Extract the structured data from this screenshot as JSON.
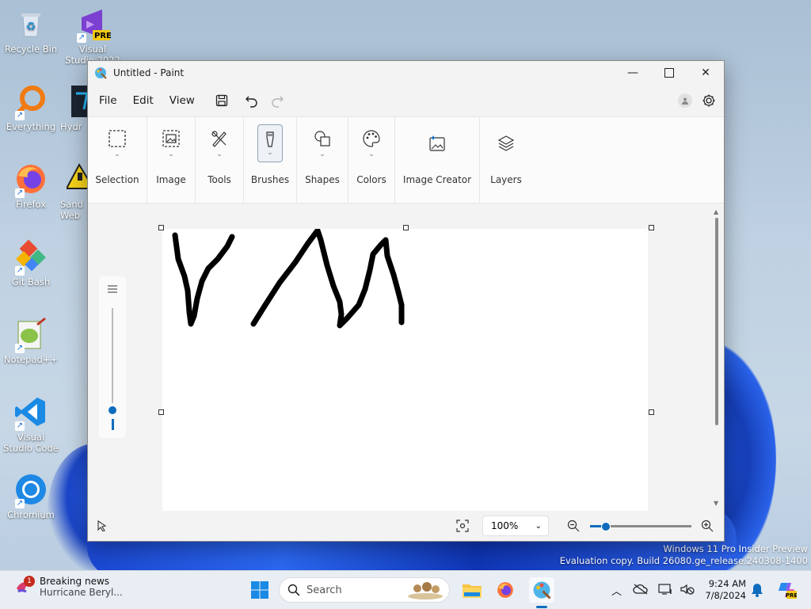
{
  "desktop": {
    "icons": [
      {
        "label": "Recycle Bin"
      },
      {
        "label": "Visual Studio 2022",
        "badge": "PRE"
      },
      {
        "label": "Everything"
      },
      {
        "label": "Hydr"
      },
      {
        "label": "Firefox"
      },
      {
        "label": "Sand Web"
      },
      {
        "label": "Git Bash"
      },
      {
        "label": "Notepad++"
      },
      {
        "label": "Visual Studio Code"
      },
      {
        "label": "Chromium"
      }
    ],
    "watermark": {
      "line1": "Windows 11 Pro Insider Preview",
      "line2": "Evaluation copy. Build 26080.ge_release.240308-1400"
    }
  },
  "paint": {
    "title": "Untitled - Paint",
    "menu": [
      "File",
      "Edit",
      "View"
    ],
    "ribbon": {
      "groups": [
        "Selection",
        "Image",
        "Tools",
        "Brushes",
        "Shapes",
        "Colors",
        "Image Creator",
        "Layers"
      ]
    },
    "status": {
      "zoom": "100%"
    }
  },
  "taskbar": {
    "news_title": "Breaking news",
    "news_sub": "Hurricane Beryl...",
    "news_badge": "1",
    "search_label": "Search",
    "time": "9:24 AM",
    "date": "7/8/2024"
  },
  "colors": {
    "accent": "#0f6cbd",
    "stroke": "#000000"
  }
}
